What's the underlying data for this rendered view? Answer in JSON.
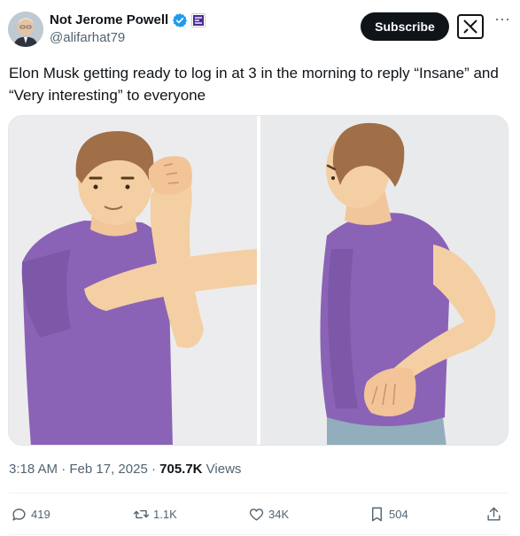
{
  "author": {
    "name": "Not Jerome Powell",
    "handle": "@alifarhat79",
    "verified_color": "#1d9bf0"
  },
  "header": {
    "subscribe_label": "Subscribe",
    "grok_icon": "grok-icon",
    "more_icon": "more-icon"
  },
  "tweet": {
    "text": "Elon Musk getting ready to log in at 3 in the morning to reply “Insane” and “Very interesting” to everyone"
  },
  "meta": {
    "time": "3:18 AM",
    "sep1": " · ",
    "date": "Feb 17, 2025",
    "sep2": " · ",
    "views_count": "705.7K",
    "views_label": " Views"
  },
  "actions": {
    "replies": "419",
    "reposts": "1.1K",
    "likes": "34K",
    "bookmarks": "504"
  },
  "colors": {
    "shirt": "#8a63b6",
    "skin": "#f4cfa3",
    "hair": "#a06e47",
    "jeans": "#92aebc"
  }
}
